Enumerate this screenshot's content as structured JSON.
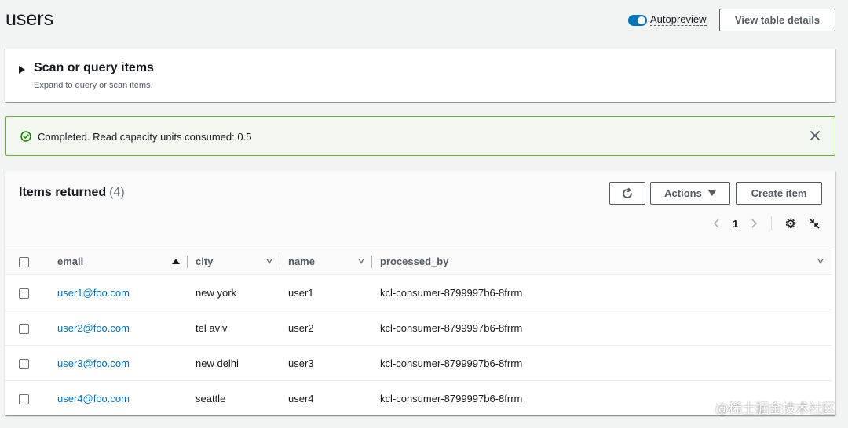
{
  "page": {
    "title": "users"
  },
  "header": {
    "autopreview_label": "Autopreview",
    "autopreview_on": true,
    "view_details_label": "View table details"
  },
  "scan": {
    "title": "Scan or query items",
    "description": "Expand to query or scan items."
  },
  "flash": {
    "message": "Completed. Read capacity units consumed: 0.5",
    "status_color": "#1d8102"
  },
  "items": {
    "title": "Items returned",
    "count": "(4)",
    "actions_label": "Actions",
    "create_label": "Create item",
    "page": "1",
    "columns": [
      "email",
      "city",
      "name",
      "processed_by"
    ],
    "rows": [
      {
        "email": "user1@foo.com",
        "city": "new york",
        "name": "user1",
        "processed_by": "kcl-consumer-8799997b6-8frrm"
      },
      {
        "email": "user2@foo.com",
        "city": "tel aviv",
        "name": "user2",
        "processed_by": "kcl-consumer-8799997b6-8frrm"
      },
      {
        "email": "user3@foo.com",
        "city": "new delhi",
        "name": "user3",
        "processed_by": "kcl-consumer-8799997b6-8frrm"
      },
      {
        "email": "user4@foo.com",
        "city": "seattle",
        "name": "user4",
        "processed_by": "kcl-consumer-8799997b6-8frrm"
      }
    ]
  },
  "watermark": "@稀土掘金技术社区",
  "colors": {
    "accent": "#0073bb",
    "success_border": "#6aaf35"
  }
}
